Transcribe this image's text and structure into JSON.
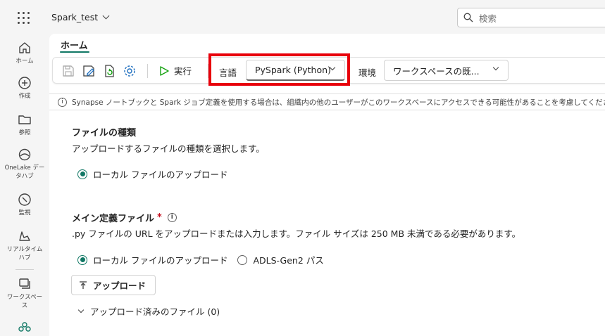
{
  "topbar": {
    "workspace_name": "Spark_test",
    "search_placeholder": "検索"
  },
  "rail": {
    "items": [
      {
        "label": "ホーム",
        "icon": "home-icon"
      },
      {
        "label": "作成",
        "icon": "create-icon"
      },
      {
        "label": "参照",
        "icon": "browse-icon"
      },
      {
        "label": "OneLake データハブ",
        "icon": "onelake-icon"
      },
      {
        "label": "監視",
        "icon": "monitor-icon"
      },
      {
        "label": "リアルタイム ハブ",
        "icon": "realtime-hub-icon"
      },
      {
        "label": "ワークスペース",
        "icon": "workspaces-icon"
      }
    ]
  },
  "tabs": {
    "home": "ホーム"
  },
  "toolbar": {
    "run_label": "実行",
    "language_label": "言語",
    "language_value": "PySpark (Python)",
    "environment_label": "環境",
    "environment_value": "ワークスペースの既..."
  },
  "info": {
    "text": "Synapse ノートブックと Spark ジョブ定義を使用する場合は、組織内の他のユーザーがこのワークスペースにアクセスできる可能性があることを考慮してください。"
  },
  "file_type": {
    "title": "ファイルの種類",
    "description": "アップロードするファイルの種類を選択します。",
    "option_local": "ローカル ファイルのアップロード"
  },
  "main_def": {
    "title": "メイン定義ファイル",
    "required_mark": "*",
    "description": ".py ファイルの URL をアップロードまたは入力します。ファイル サイズは 250 MB 未満である必要があります。",
    "option_local": "ローカル ファイルのアップロード",
    "option_adls": "ADLS-Gen2 パス",
    "upload_button": "アップロード",
    "uploaded_files": "アップロード済みのファイル (0)"
  },
  "colors": {
    "accent": "#117865",
    "highlight": "#e8000b",
    "run_green": "#13a10e"
  }
}
